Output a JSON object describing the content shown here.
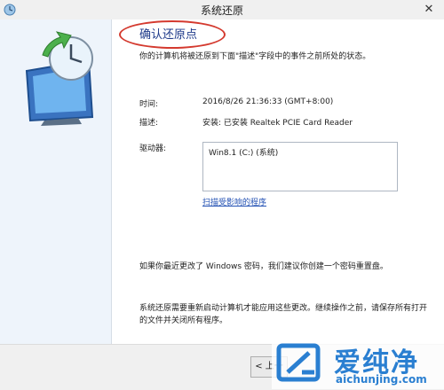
{
  "window": {
    "title": "系统还原",
    "close": "✕"
  },
  "heading": "确认还原点",
  "description": "你的计算机将被还原到下面\"描述\"字段中的事件之前所处的状态。",
  "details": {
    "time_label": "时间:",
    "time_value": "2016/8/26 21:36:33 (GMT+8:00)",
    "desc_label": "描述:",
    "desc_value": "安装: 已安装 Realtek PCIE Card Reader",
    "drives_label": "驱动器:",
    "drives": [
      "Win8.1 (C:) (系统)"
    ]
  },
  "scan_link": "扫描受影响的程序",
  "notes": {
    "password": "如果你最近更改了 Windows 密码，我们建议你创建一个密码重置盘。",
    "restart": "系统还原需要重新启动计算机才能应用这些更改。继续操作之前，请保存所有打开的文件并关闭所有程序。"
  },
  "buttons": {
    "prev": "< 上一"
  },
  "watermark": {
    "brand": "爱纯净",
    "site": "aichunjing.com"
  },
  "colors": {
    "accent": "#1e3a8a",
    "link": "#2452b4",
    "highlight_ring": "#d43a2f",
    "watermark": "#2a7fd1"
  }
}
